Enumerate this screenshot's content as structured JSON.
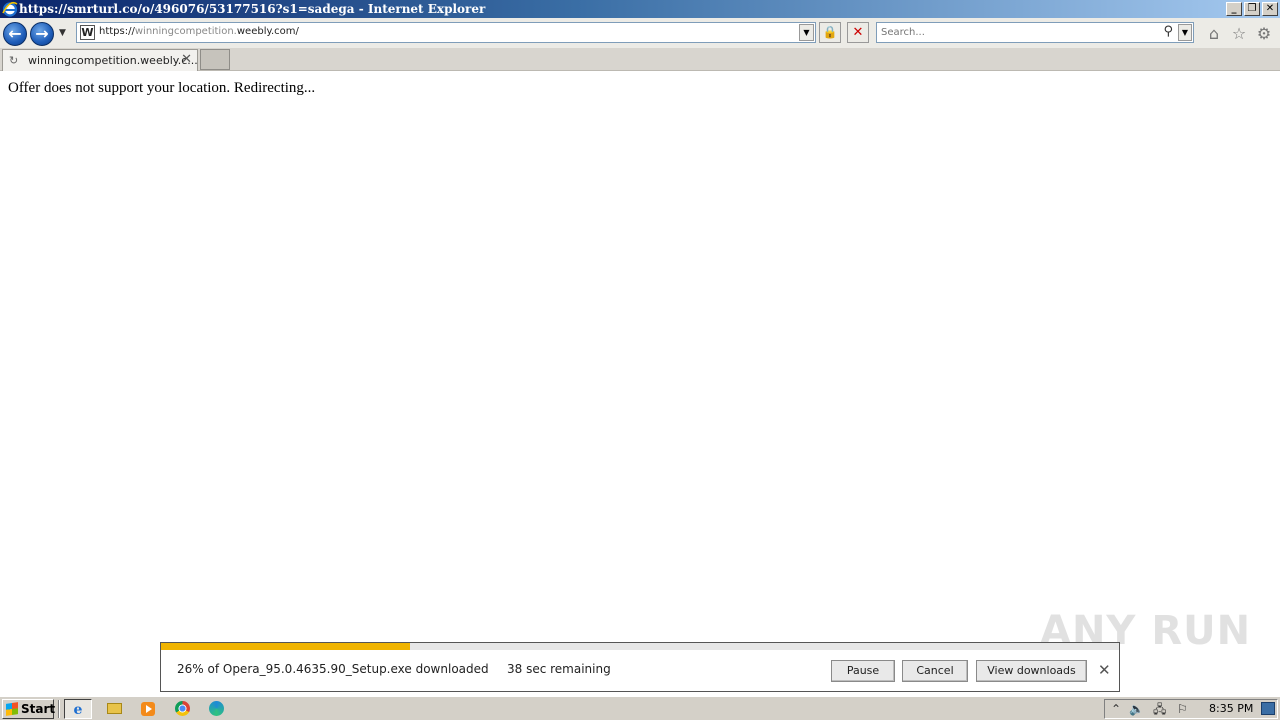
{
  "window": {
    "title": "https://smrturl.co/o/496076/53177516?s1=sadega - Internet Explorer",
    "min_label": "_",
    "restore_label": "❐",
    "close_label": "✕"
  },
  "navbar": {
    "back_label": "←",
    "forward_label": "→",
    "address_prefix": "https://",
    "address_sub": "winningcompetition.",
    "address_domain": "weebly.com/",
    "site_icon_letter": "W",
    "search_placeholder": "Search..."
  },
  "tabs": [
    {
      "label": "winningcompetition.weebly.c...",
      "active": true
    }
  ],
  "page": {
    "message": "Offer does not support your location. Redirecting..."
  },
  "download": {
    "status": "26% of Opera_95.0.4635.90_Setup.exe downloaded",
    "remaining": "38 sec remaining",
    "progress_percent": 26,
    "pause_label": "Pause",
    "cancel_label": "Cancel",
    "view_label": "View downloads",
    "accent_color": "#f0b400"
  },
  "taskbar": {
    "start_label": "Start",
    "clock": "8:35 PM",
    "apps": [
      "internet-explorer",
      "file-explorer",
      "media-player",
      "chrome",
      "edge"
    ]
  },
  "watermark": "ANY RUN"
}
